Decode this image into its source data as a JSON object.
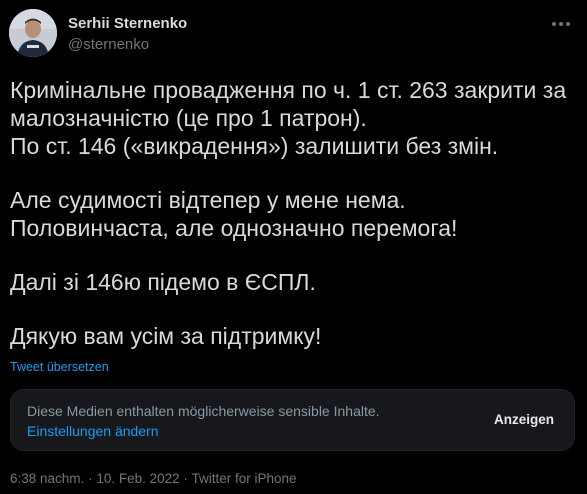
{
  "author": {
    "name": "Serhii Sternenko",
    "handle": "@sternenko"
  },
  "icons": {
    "more": "more-dots-icon",
    "avatar": "avatar-photo"
  },
  "tweet": {
    "lines": [
      "Кримінальне провадження по ч. 1 ст. 263 закрити за",
      "малозначністю (це про 1 патрон).",
      "По ст. 146 («викрадення») залишити без змін.",
      "Але судимості відтепер у мене нема.",
      "Половинчаста, але однозначно перемога!",
      "Далі зі 146ю підемо в ЄСПЛ.",
      "Дякую вам усім за підтримку!"
    ]
  },
  "translate_label": "Tweet übersetzen",
  "sensitive": {
    "message": "Diese Medien enthalten möglicherweise sensible Inhalte.",
    "settings_label": "Einstellungen ändern",
    "show_label": "Anzeigen"
  },
  "meta": {
    "time": "6:38 nachm.",
    "date": "10. Feb. 2022",
    "source": "Twitter for iPhone",
    "separator": "·"
  },
  "colors": {
    "background": "#000000",
    "text": "#d9d9d9",
    "muted": "#6e767d",
    "link": "#1d9bf0",
    "box": "#16181c"
  }
}
